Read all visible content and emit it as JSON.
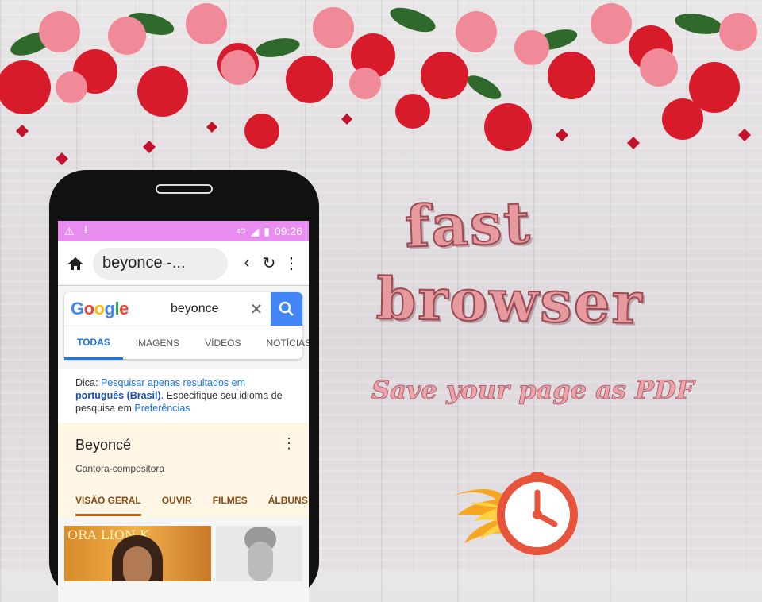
{
  "statusbar": {
    "network": "4G",
    "time": "09:26"
  },
  "toolbar": {
    "url_text": "beyonce -..."
  },
  "google": {
    "logo": [
      "G",
      "o",
      "o",
      "g",
      "l",
      "e"
    ],
    "logo_colors": [
      "#4285f4",
      "#ea4335",
      "#fbbc05",
      "#4285f4",
      "#34a853",
      "#ea4335"
    ],
    "query": "beyonce",
    "tabs": [
      "TODAS",
      "IMAGENS",
      "VÍDEOS",
      "NOTÍCIAS"
    ]
  },
  "tip": {
    "prefix": "Dica: ",
    "link1": "Pesquisar apenas resultados em",
    "link_bold": "português (Brasil)",
    "middle": ". Especifique seu idioma de pesquisa em ",
    "link2": "Preferências"
  },
  "knowledge": {
    "title": "Beyoncé",
    "subtitle": "Cantora-compositora",
    "tabs": [
      "VISÃO GERAL",
      "OUVIR",
      "FILMES",
      "ÁLBUNS"
    ],
    "img_text": "ORA   LION K"
  },
  "promo": {
    "word1": "fast",
    "word2": "browser",
    "tagline": "Save your page as PDF"
  },
  "colors": {
    "statusbar": "#e98ef0",
    "accent": "#1a73e8",
    "promo_pink": "#e79a9e"
  }
}
